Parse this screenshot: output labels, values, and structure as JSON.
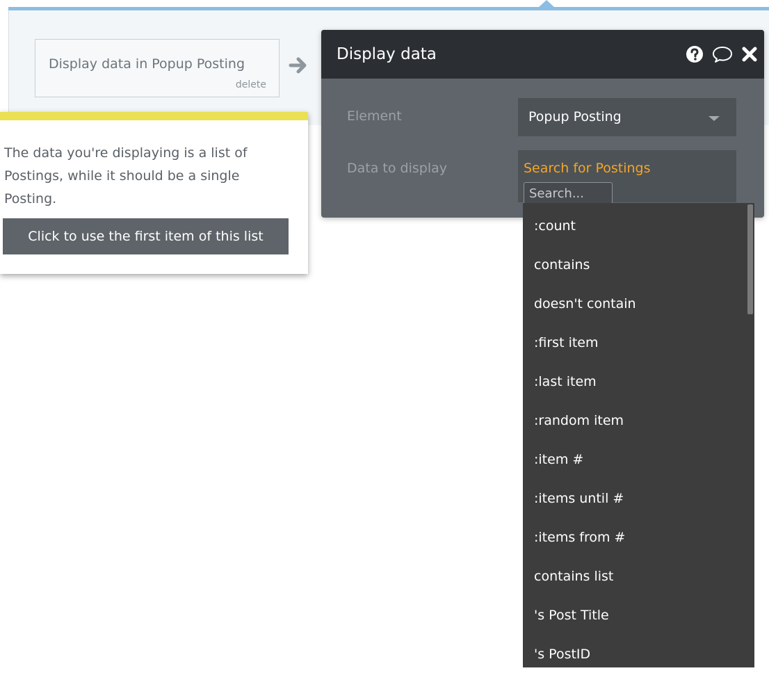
{
  "workflow": {
    "action_label": "Display data in Popup Posting",
    "delete_label": "delete"
  },
  "panel": {
    "title": "Display data",
    "icons": [
      "help-icon",
      "comment-icon",
      "close-icon"
    ],
    "fields": {
      "element_label": "Element",
      "element_value": "Popup Posting",
      "data_label": "Data to display",
      "data_expression": "Search for Postings",
      "search_placeholder": "Search..."
    }
  },
  "dropdown": {
    "items": [
      ":count",
      "contains",
      "doesn't contain",
      ":first item",
      ":last item",
      ":random item",
      ":item #",
      ":items until #",
      ":items from #",
      "contains list",
      "'s Post Title",
      "'s PostID"
    ]
  },
  "issue": {
    "message": "The data you're displaying is a list of Postings, while it should be a single Posting.",
    "button_label": "Click to use the first item of this list"
  },
  "colors": {
    "accent_blue": "#8cbde3",
    "expression_orange": "#f5a623",
    "warning_yellow": "#ebe052",
    "panel_bg": "#5f656b",
    "header_bg": "#2b2f33",
    "dropdown_bg": "#3d3d3d"
  }
}
